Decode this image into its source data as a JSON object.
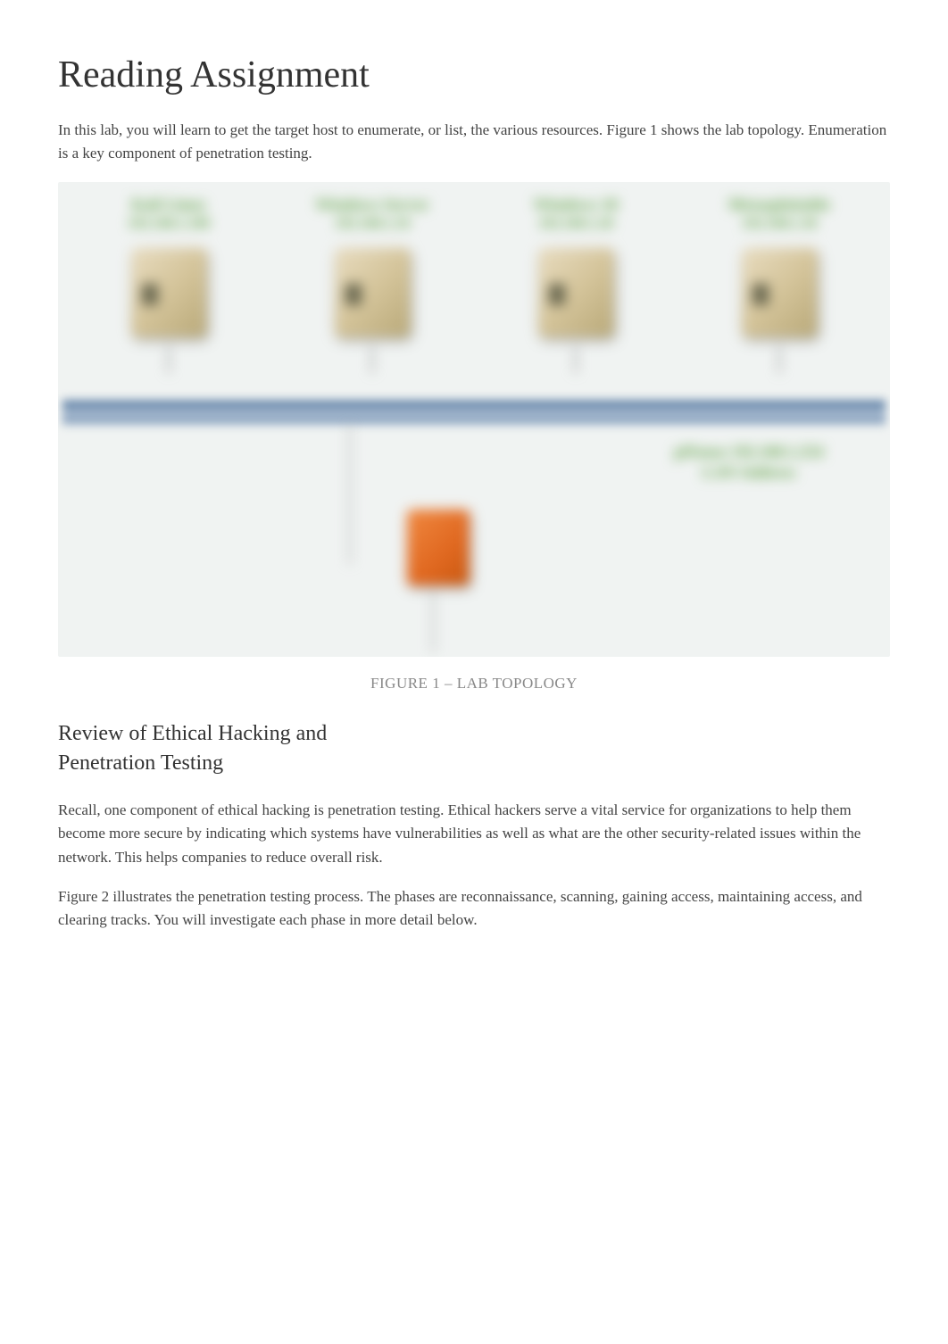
{
  "title": "Reading Assignment",
  "intro": "In this lab, you will learn to get the target host to enumerate, or list, the various resources. Figure 1 shows the lab topology. Enumeration is a key component of penetration testing.",
  "figure1": {
    "caption": "FIGURE 1 – LAB TOPOLOGY",
    "nodes": [
      {
        "label": "Kali Linux",
        "ip": "192.168.1.100"
      },
      {
        "label": "Windows Server",
        "ip": "192.168.1.10"
      },
      {
        "label": "Windows 10",
        "ip": "192.168.1.20"
      },
      {
        "label": "Metasploitable",
        "ip": "192.168.1.30"
      }
    ],
    "bottom": {
      "label1": "pfSense  192.168.1.254",
      "label2": "LAN  Address"
    }
  },
  "section_heading": "Review of Ethical Hacking and Penetration Testing",
  "para1": "Recall, one component of ethical hacking is penetration testing. Ethical hackers serve a vital service for organizations to help them become more secure by indicating which systems have vulnerabilities as well as what are the other security-related issues within the network. This helps companies to reduce overall risk.",
  "para2": "Figure 2 illustrates the penetration testing process. The phases are reconnaissance, scanning, gaining access, maintaining access, and clearing tracks. You will investigate each phase in more detail below."
}
